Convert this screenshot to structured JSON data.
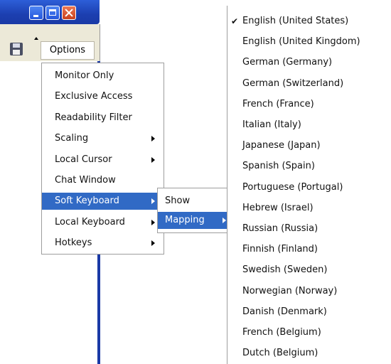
{
  "window": {
    "controls": [
      "minimize",
      "maximize",
      "close"
    ]
  },
  "toolbar": {
    "save_icon": "floppy-disk-icon",
    "options_label": "Options"
  },
  "options_menu": {
    "items": [
      {
        "label": "Monitor Only",
        "submenu": false
      },
      {
        "label": "Exclusive Access",
        "submenu": false
      },
      {
        "label": "Readability Filter",
        "submenu": false
      },
      {
        "label": "Scaling",
        "submenu": true
      },
      {
        "label": "Local Cursor",
        "submenu": true
      },
      {
        "label": "Chat Window",
        "submenu": false
      },
      {
        "label": "Soft Keyboard",
        "submenu": true,
        "active": true
      },
      {
        "label": "Local Keyboard",
        "submenu": true
      },
      {
        "label": "Hotkeys",
        "submenu": true
      }
    ]
  },
  "soft_keyboard_menu": {
    "items": [
      {
        "label": "Show",
        "submenu": false
      },
      {
        "label": "Mapping",
        "submenu": true,
        "active": true
      }
    ]
  },
  "mapping_menu": {
    "checked_index": 0,
    "items": [
      "English (United States)",
      "English (United Kingdom)",
      "German (Germany)",
      "German (Switzerland)",
      "French (France)",
      "Italian (Italy)",
      "Japanese (Japan)",
      "Spanish (Spain)",
      "Portuguese (Portugal)",
      "Hebrew (Israel)",
      "Russian (Russia)",
      "Finnish (Finland)",
      "Swedish (Sweden)",
      "Norwegian (Norway)",
      "Danish (Denmark)",
      "French (Belgium)",
      "Dutch (Belgium)"
    ]
  },
  "colors": {
    "highlight": "#316ac5",
    "titlebar": "#1c3fb0"
  }
}
